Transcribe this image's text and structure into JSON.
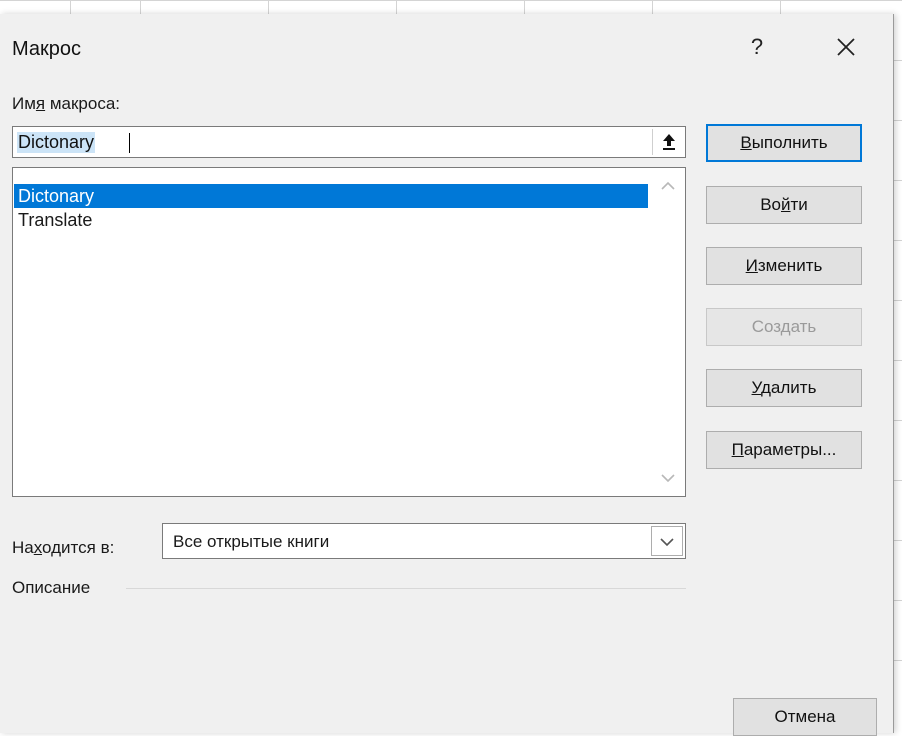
{
  "dialog": {
    "title": "Макрос",
    "help_label": "?",
    "close_icon": "close-icon"
  },
  "macro_name": {
    "label_pre": "Им",
    "label_access": "я",
    "label_post": " макроса:",
    "value": "Dictonary",
    "upload_icon": "collapse-dialog-icon"
  },
  "macro_list": {
    "items": [
      "Dictonary",
      "Translate"
    ],
    "selected": "Dictonary"
  },
  "buttons": {
    "run": {
      "access": "В",
      "rest": "ыполнить"
    },
    "step_into": {
      "pre": "Во",
      "access": "й",
      "rest": "ти"
    },
    "edit": {
      "access": "И",
      "rest": "зменить"
    },
    "create": "Создать",
    "delete": {
      "access": "У",
      "rest": "далить"
    },
    "options": {
      "access": "П",
      "rest": "араметры..."
    },
    "cancel": "Отмена"
  },
  "location": {
    "label_pre": "На",
    "label_access": "х",
    "label_post": "одится в:",
    "value": "Все открытые книги"
  },
  "description": {
    "label": "Описание"
  },
  "colors": {
    "accent": "#0078d7",
    "selection": "#0078d7",
    "dialog_bg": "#f0f0f0"
  }
}
